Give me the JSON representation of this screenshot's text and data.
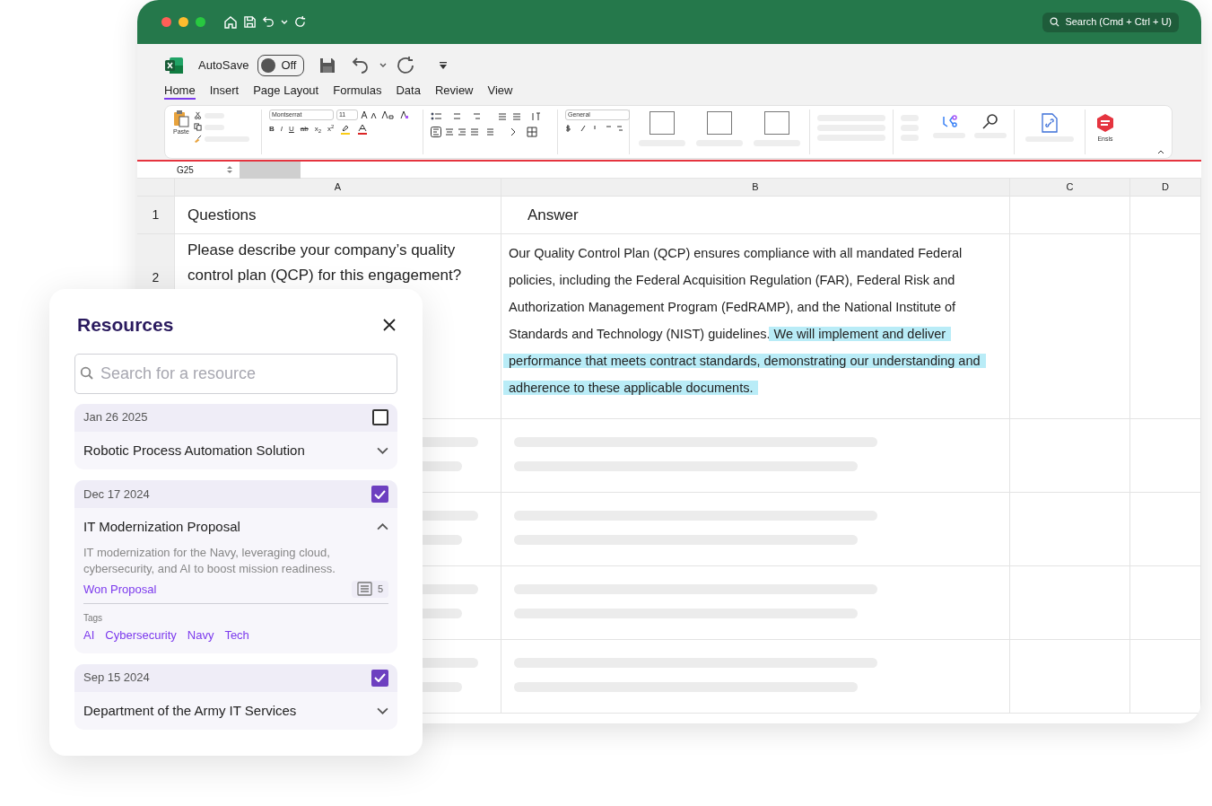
{
  "title_bar": {
    "search": {
      "placeholder": "Search (Cmd + Ctrl + U)"
    }
  },
  "quick_access": {
    "autosave_label": "AutoSave",
    "autosave": {
      "on": false,
      "label": "Off"
    }
  },
  "menu_tabs": [
    {
      "label": "Home",
      "selected": true
    },
    {
      "label": "Insert",
      "selected": false
    },
    {
      "label": "Page Layout",
      "selected": false
    },
    {
      "label": "Formulas",
      "selected": false
    },
    {
      "label": "Data",
      "selected": false
    },
    {
      "label": "Review",
      "selected": false
    },
    {
      "label": "View",
      "selected": false
    }
  ],
  "ribbon": {
    "paste_label": "Paste",
    "font": "Montserrat",
    "font_size": "11",
    "format_buttons": [
      "B",
      "I",
      "U",
      "ab",
      "x$_{2}$",
      "x$^{2}$"
    ],
    "number_format": "General",
    "addin_label": "Ensis"
  },
  "name_box": "G25",
  "sheet": {
    "columns": [
      "A",
      "B",
      "C",
      "D"
    ],
    "header_row": {
      "number": "1",
      "question": "Questions",
      "answer": "Answer"
    },
    "answer_row": {
      "number": "2",
      "question": "Please describe your company’s quality control plan (QCP) for this engagement?",
      "answer": [
        {
          "text": "Our Quality Control Plan (QCP) ensures compliance with all mandated Federal policies, including the Federal Acquisition Regulation (FAR), Federal Risk and Authorization Management Program (FedRAMP), and the National Institute of Standards and Technology (NIST) guidelines. ",
          "highlighted": false
        },
        {
          "text": "We will implement and deliver performance that meets contract standards, demonstrating our understanding and adherence to these applicable documents.",
          "highlighted": true
        }
      ]
    },
    "placeholder_rows": [
      {
        "kind": "skeleton"
      },
      {
        "kind": "skeleton"
      },
      {
        "kind": "skeleton"
      },
      {
        "kind": "skeleton"
      }
    ]
  },
  "resources_panel": {
    "title": "Resources",
    "search": {
      "placeholder": "Search for a resource"
    },
    "items": [
      {
        "date": "Jan 26 2025",
        "checked": false,
        "title": "Robotic Process Automation Solution",
        "expanded": false
      },
      {
        "date": "Dec 17 2024",
        "checked": true,
        "title": "IT Modernization Proposal",
        "expanded": true,
        "description": "IT modernization for the Navy, leveraging cloud, cybersecurity, and AI to boost mission readiness.",
        "status": "Won Proposal",
        "document_count": "5",
        "tags_label": "Tags",
        "tags": [
          "AI",
          "Cybersecurity",
          "Navy",
          "Tech"
        ]
      },
      {
        "date": "Sep 15 2024",
        "checked": true,
        "title": "Department of the Army IT Services",
        "expanded": false
      }
    ]
  }
}
